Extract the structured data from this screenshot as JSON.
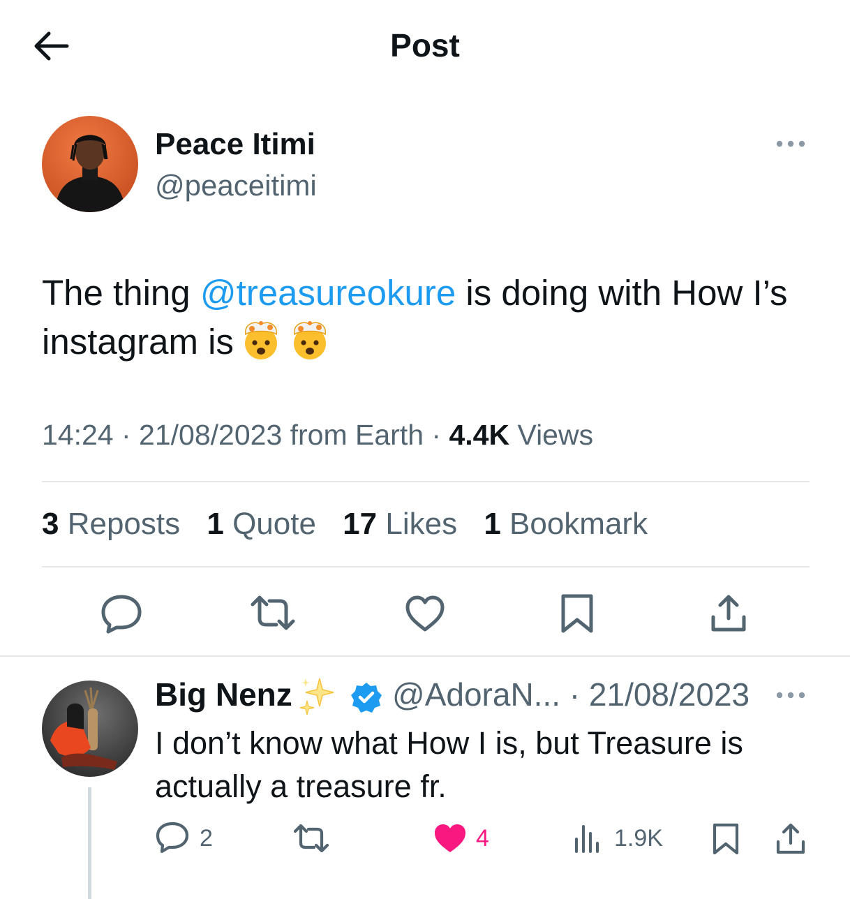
{
  "header": {
    "title": "Post"
  },
  "post": {
    "author_name": "Peace Itimi",
    "author_handle": "@peaceitimi",
    "text_before": "The thing ",
    "mention": "@treasureokure",
    "text_after": " is doing with How I’s instagram is",
    "emoji": [
      "exploding-head-emoji",
      "exploding-head-emoji"
    ],
    "time": "14:24",
    "sep1": " · ",
    "date": "21/08/2023",
    "source": " from Earth",
    "sep2": " · ",
    "views_count": "4.4K",
    "views_label": " Views",
    "stats": [
      {
        "count": "3",
        "label": " Reposts"
      },
      {
        "count": "1",
        "label": " Quote"
      },
      {
        "count": "17",
        "label": " Likes"
      },
      {
        "count": "1",
        "label": " Bookmark"
      }
    ],
    "actions": [
      "reply-icon",
      "repost-icon",
      "like-icon",
      "bookmark-icon",
      "share-icon"
    ]
  },
  "reply": {
    "author_name": "Big Nenz",
    "handle": "@AdoraN...",
    "sep": " · ",
    "date": "21/08/2023",
    "text": "I don’t know what How I is, but Treasure is actually a treasure fr.",
    "reply_count": "2",
    "like_count": "4",
    "views": "1.9K",
    "liked": true
  },
  "colors": {
    "accent": "#1d9bf0",
    "text": "#0f1419",
    "muted": "#536471",
    "like": "#f91880",
    "verified": "#1d9bf0"
  }
}
